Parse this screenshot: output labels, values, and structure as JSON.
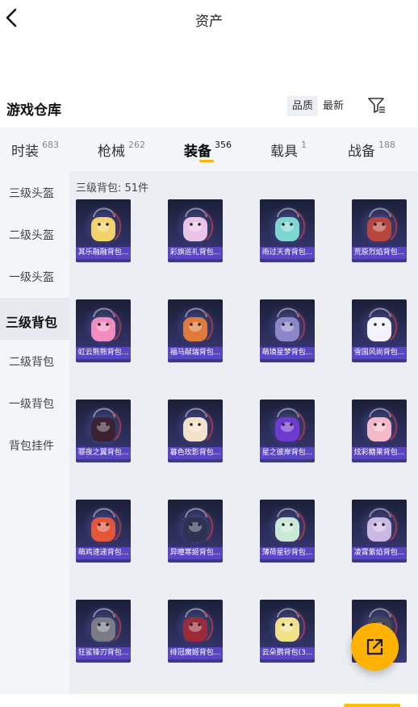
{
  "header": {
    "title": "资产"
  },
  "section": {
    "title": "游戏仓库",
    "sort_options": [
      "品质",
      "最新"
    ],
    "active_sort": 1
  },
  "tabs": [
    {
      "label": "时装",
      "count": "683"
    },
    {
      "label": "枪械",
      "count": "262"
    },
    {
      "label": "装备",
      "count": "356",
      "active": true
    },
    {
      "label": "载具",
      "count": "1"
    },
    {
      "label": "战备",
      "count": "188"
    }
  ],
  "sidebar": {
    "items": [
      "三级头盔",
      "二级头盔",
      "一级头盔",
      "三级背包",
      "二级背包",
      "一级背包",
      "背包挂件"
    ],
    "active_index": 3
  },
  "content": {
    "count_label": "三级背包: 51件",
    "items": [
      {
        "name": "其乐融融背包...",
        "color": "#f2d36b"
      },
      {
        "name": "彩旗巡礼背包...",
        "color": "#e9c4e6"
      },
      {
        "name": "雨过天青背包...",
        "color": "#7fd6d0"
      },
      {
        "name": "荒原烈焰背包...",
        "color": "#b8463c"
      },
      {
        "name": "虹云熊熊背包...",
        "color": "#f08cc0"
      },
      {
        "name": "福马献瑞背包...",
        "color": "#e07a3a"
      },
      {
        "name": "萌境星梦背包...",
        "color": "#8c86c8"
      },
      {
        "name": "雪国风尚背包...",
        "color": "#f4f2ff"
      },
      {
        "name": "罪夜之翼背包...",
        "color": "#3a2230"
      },
      {
        "name": "暮色玫影背包...",
        "color": "#f3e1c9"
      },
      {
        "name": "星之彼岸背包...",
        "color": "#6e3ad0"
      },
      {
        "name": "炫彩糖果背包...",
        "color": "#f3b9c9"
      },
      {
        "name": "萌鸡速递背包...",
        "color": "#e4553a"
      },
      {
        "name": "异瞳寒姬背包...",
        "color": "#2e3352"
      },
      {
        "name": "薄荷星砂背包...",
        "color": "#c9e8d6"
      },
      {
        "name": "凌霄紫焰背包...",
        "color": "#cbb8e3"
      },
      {
        "name": "狂鲨锋刃背包...",
        "color": "#7a7b86"
      },
      {
        "name": "绯冠魔姬背包...",
        "color": "#9c2b3a"
      },
      {
        "name": "云朵鹦背包(3...",
        "color": "#f1e28a"
      },
      {
        "name": "",
        "color": "#4a4a55"
      }
    ]
  },
  "fab": {
    "icon": "share-icon"
  }
}
